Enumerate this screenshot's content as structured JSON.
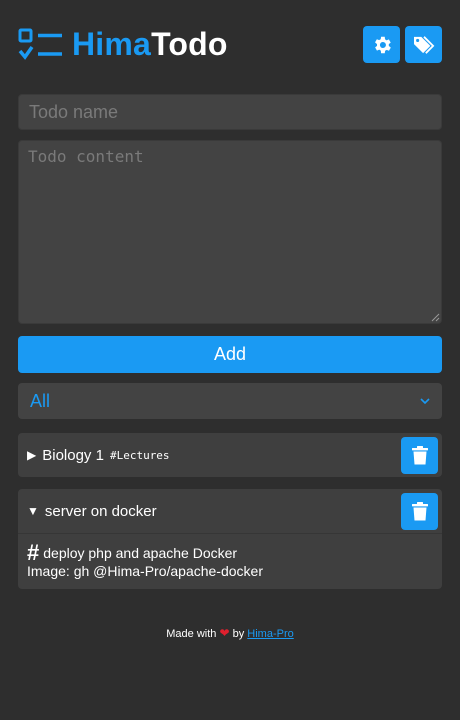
{
  "header": {
    "title_accent": "Hima",
    "title_rest": "Todo",
    "settings_icon": "gear-icon",
    "tags_icon": "tags-icon",
    "accent_color": "#1a9af3"
  },
  "form": {
    "name_placeholder": "Todo name",
    "content_placeholder": "Todo content",
    "add_label": "Add"
  },
  "filter": {
    "selected": "All",
    "icon": "chevron-down-icon"
  },
  "todos": [
    {
      "title": "Biology 1",
      "tag": "#Lectures",
      "expanded": false,
      "toggle_icon": "▶"
    },
    {
      "title": "server on docker",
      "expanded": true,
      "toggle_icon": "▼",
      "hash": "#",
      "line1": "deploy php and apache Docker",
      "line2": "Image: gh @Hima-Pro/apache-docker"
    }
  ],
  "footer": {
    "made_with": "Made with",
    "by": "by",
    "author": "Hima-Pro",
    "heart": "❤"
  }
}
